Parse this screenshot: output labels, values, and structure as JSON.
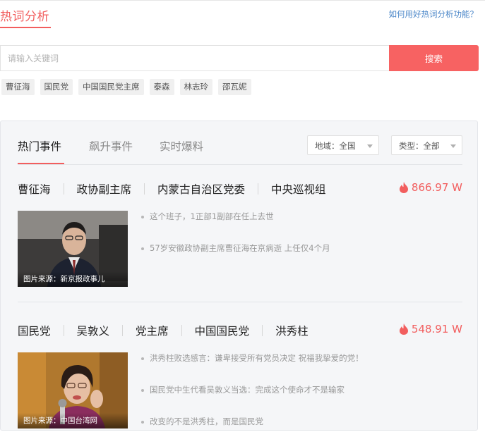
{
  "header": {
    "title": "热词分析",
    "help_link": "如何用好热词分析功能？"
  },
  "search": {
    "placeholder": "请输入关键词",
    "button_label": "搜索"
  },
  "hot_tags": [
    "曹征海",
    "国民党",
    "中国国民党主席",
    "泰森",
    "林志玲",
    "邵瓦妮"
  ],
  "tabs": [
    {
      "label": "热门事件",
      "active": true
    },
    {
      "label": "飙升事件",
      "active": false
    },
    {
      "label": "实时爆料",
      "active": false
    }
  ],
  "filters": {
    "region": "地域：全国",
    "type": "类型：全部"
  },
  "events": [
    {
      "keywords": [
        "曹征海",
        "政协副主席",
        "内蒙古自治区党委",
        "中央巡视组"
      ],
      "heat": "866.97 W",
      "image_caption": "图片来源：新京报政事儿",
      "news": [
        "这个班子，1正部1副部在任上去世",
        "57岁安徽政协副主席曹征海在京病逝 上任仅4个月"
      ]
    },
    {
      "keywords": [
        "国民党",
        "吴敦义",
        "党主席",
        "中国国民党",
        "洪秀柱"
      ],
      "heat": "548.91 W",
      "image_caption": "图片来源：中国台湾网",
      "news": [
        "洪秀柱败选感言：谦卑接受所有党员决定 祝福我挚爱的党！",
        "国民党中生代看吴敦义当选：完成这个使命才不是输家",
        "改变的不是洪秀柱，而是国民党"
      ]
    }
  ],
  "colors": {
    "accent": "#f25e5e",
    "link": "#4a86c8",
    "panel_bg": "#f5f6f8"
  }
}
